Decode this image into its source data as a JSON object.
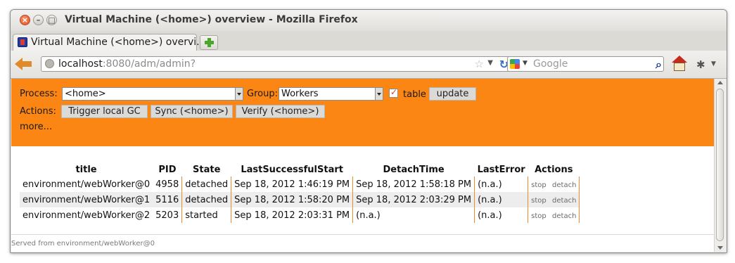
{
  "window": {
    "title": "Virtual Machine (<home>) overview - Mozilla Firefox",
    "close": "×",
    "minimize": "–",
    "maximize": "□"
  },
  "tab": {
    "title": "Virtual Machine (<home>) overvi..."
  },
  "navbar": {
    "url_host": "localhost",
    "url_rest": ":8080/adm/admin?",
    "search_placeholder": "Google"
  },
  "controls": {
    "process_label": "Process:",
    "process_value": "<home>",
    "group_label": "Group:",
    "group_value": "Workers",
    "table_checked": true,
    "table_label": "table",
    "update_button": "update",
    "actions_label": "Actions:",
    "actions": [
      "Trigger local GC",
      "Sync (<home>)",
      "Verify (<home>)"
    ],
    "more_link": "more..."
  },
  "table": {
    "headers": [
      "title",
      "PID",
      "State",
      "LastSuccessfulStart",
      "DetachTime",
      "LastError",
      "Actions"
    ],
    "rows": [
      {
        "title": "environment/webWorker@0",
        "pid": "4958",
        "state": "detached",
        "last_start": "Sep 18, 2012 1:46:19 PM",
        "detach_time": "Sep 18, 2012 1:58:18 PM",
        "last_error": "(n.a.)",
        "stop": "stop",
        "detach": "detach"
      },
      {
        "title": "environment/webWorker@1",
        "pid": "5116",
        "state": "detached",
        "last_start": "Sep 18, 2012 1:58:20 PM",
        "detach_time": "Sep 18, 2012 2:03:29 PM",
        "last_error": "(n.a.)",
        "stop": "stop",
        "detach": "detach"
      },
      {
        "title": "environment/webWorker@2",
        "pid": "5203",
        "state": "started",
        "last_start": "Sep 18, 2012 2:03:31 PM",
        "detach_time": "(n.a.)",
        "last_error": "(n.a.)",
        "stop": "stop",
        "detach": "detach"
      }
    ]
  },
  "footer": {
    "text": "Served from environment/webWorker@0"
  },
  "colors": {
    "panel": "#fb8613",
    "row_alt": "#ededed",
    "separator": "#f08a2a"
  }
}
